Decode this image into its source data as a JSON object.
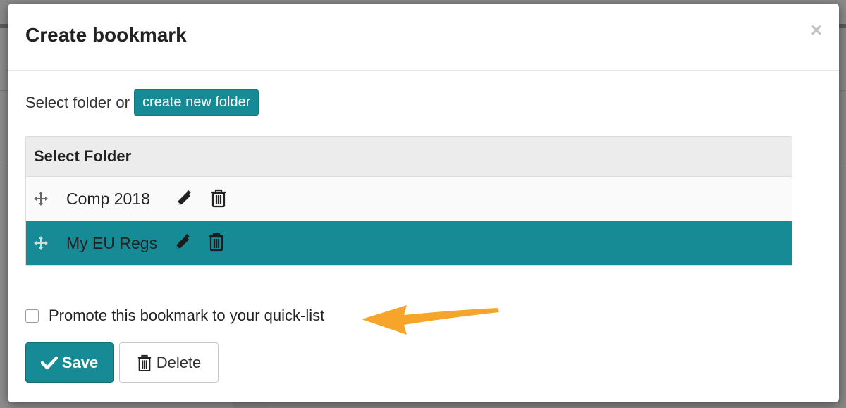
{
  "modal": {
    "title": "Create bookmark",
    "close_glyph": "×"
  },
  "folder_picker": {
    "intro_text": "Select folder or",
    "create_button_label": "create new folder",
    "table_header": "Select Folder",
    "folders": [
      {
        "name": "Comp 2018",
        "selected": false
      },
      {
        "name": "My EU Regs",
        "selected": true
      }
    ]
  },
  "promote": {
    "label": "Promote this bookmark to your quick-list",
    "checked": false
  },
  "actions": {
    "save_label": "Save",
    "delete_label": "Delete"
  },
  "colors": {
    "accent": "#178b95",
    "annotation_arrow": "#f7a42b"
  },
  "icons": {
    "drag": "move-arrows-icon",
    "edit": "pencil-icon",
    "delete": "trash-icon",
    "save": "checkmark-icon"
  }
}
